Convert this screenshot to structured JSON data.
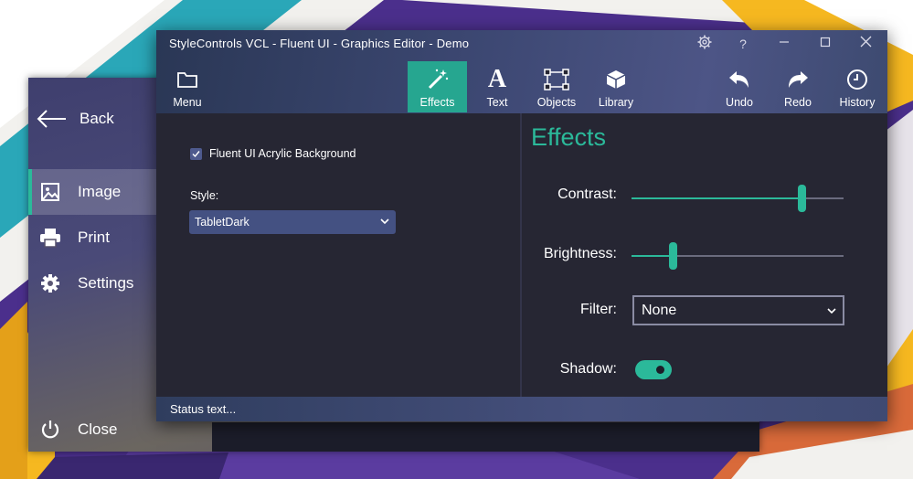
{
  "window": {
    "title": "StyleControls VCL - Fluent UI - Graphics Editor - Demo"
  },
  "navigation": {
    "back_label": "Back",
    "items": [
      {
        "label": "Image",
        "icon": "image-icon",
        "active": true
      },
      {
        "label": "Print",
        "icon": "printer-icon",
        "active": false
      },
      {
        "label": "Settings",
        "icon": "gear-icon",
        "active": false
      }
    ],
    "close_label": "Close"
  },
  "toolbar": {
    "menu_label": "Menu",
    "effects_label": "Effects",
    "text_label": "Text",
    "objects_label": "Objects",
    "library_label": "Library",
    "undo_label": "Undo",
    "redo_label": "Redo",
    "history_label": "History"
  },
  "left_panel": {
    "acrylic_checkbox_label": "Fluent UI Acrylic Background",
    "acrylic_checked": true,
    "style_label": "Style:",
    "style_value": "TabletDark"
  },
  "effects_panel": {
    "heading": "Effects",
    "contrast_label": "Contrast:",
    "contrast_value": 0.81,
    "brightness_label": "Brightness:",
    "brightness_value": 0.2,
    "filter_label": "Filter:",
    "filter_value": "None",
    "shadow_label": "Shadow:",
    "shadow_on": true
  },
  "status": {
    "text": "Status text..."
  },
  "colors": {
    "accent": "#2bb99a",
    "window_bg": "#262633",
    "combo_bg": "#445182"
  }
}
